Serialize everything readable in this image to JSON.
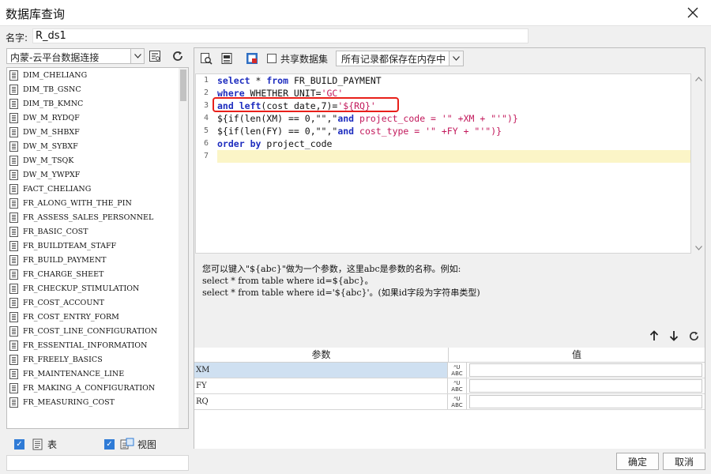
{
  "window": {
    "title": "数据库查询"
  },
  "name_field": {
    "label": "名字:",
    "value": "R_ds1"
  },
  "left_panel": {
    "connection": "内蒙-云平台数据连接",
    "tables": [
      "DIM_CHELIANG",
      "DIM_TB_GSNC",
      "DIM_TB_KMNC",
      "DW_M_RYDQF",
      "DW_M_SHBXF",
      "DW_M_SYBXF",
      "DW_M_TSQK",
      "DW_M_YWPXF",
      "FACT_CHELIANG",
      "FR_ALONG_WITH_THE_PIN",
      "FR_ASSESS_SALES_PERSONNEL",
      "FR_BASIC_COST",
      "FR_BUILDTEAM_STAFF",
      "FR_BUILD_PAYMENT",
      "FR_CHARGE_SHEET",
      "FR_CHECKUP_STIMULATION",
      "FR_COST_ACCOUNT",
      "FR_COST_ENTRY_FORM",
      "FR_COST_LINE_CONFIGURATION",
      "FR_ESSENTIAL_INFORMATION",
      "FR_FREELY_BASICS",
      "FR_MAINTENANCE_LINE",
      "FR_MAKING_A_CONFIGURATION",
      "FR_MEASURING_COST"
    ],
    "filter_table": "表",
    "filter_view": "视图"
  },
  "toolbar": {
    "share_dataset": "共享数据集",
    "memory_option": "所有记录都保存在内存中"
  },
  "editor": {
    "line_numbers": [
      "1",
      "2",
      "3",
      "4",
      "5",
      "6",
      "7"
    ],
    "lines": {
      "l1_kw1": "select",
      "l1_rest1": " * ",
      "l1_kw2": "from",
      "l1_rest2": " FR_BUILD_PAYMENT",
      "l2_kw": "where",
      "l2_rest": " WHETHER_UNIT=",
      "l2_str": "'GC'",
      "l3_kw1": "and",
      "l3_sp": " ",
      "l3_kw2": "left",
      "l3_rest": "(cost_date,7)=",
      "l3_str": "'${RQ}'",
      "l4_a": "${if(len(XM) == 0,\"\",\"",
      "l4_kw": "and",
      "l4_b": " project_code = '\" +XM + \"'\")}",
      "l5_a": "${if(len(FY) == 0,\"\",\"",
      "l5_kw": "and",
      "l5_b": " cost_type = '\" +FY + \"'\")}",
      "l6_kw1": "order",
      "l6_sp": " ",
      "l6_kw2": "by",
      "l6_rest": " project_code"
    }
  },
  "hint": {
    "line1": "您可以键入\"${abc}\"做为一个参数，这里abc是参数的名称。例如:",
    "line2": "select * from table where id=${abc}。",
    "line3": "select * from table where id='${abc}'。(如果id字段为字符串类型)"
  },
  "params": {
    "header_name": "参数",
    "header_value": "值",
    "type_label_top": "ᴬU",
    "type_label_bottom": "ABC",
    "rows": [
      {
        "name": "XM",
        "value": ""
      },
      {
        "name": "FY",
        "value": ""
      },
      {
        "name": "RQ",
        "value": ""
      }
    ]
  },
  "buttons": {
    "ok": "确定",
    "cancel": "取消"
  },
  "colors": {
    "highlight_box": "#e8201a",
    "keyword": "#1e2dbf",
    "string": "#c2185b",
    "selection": "#cfe0f1",
    "checkbox": "#2f7bd6"
  }
}
